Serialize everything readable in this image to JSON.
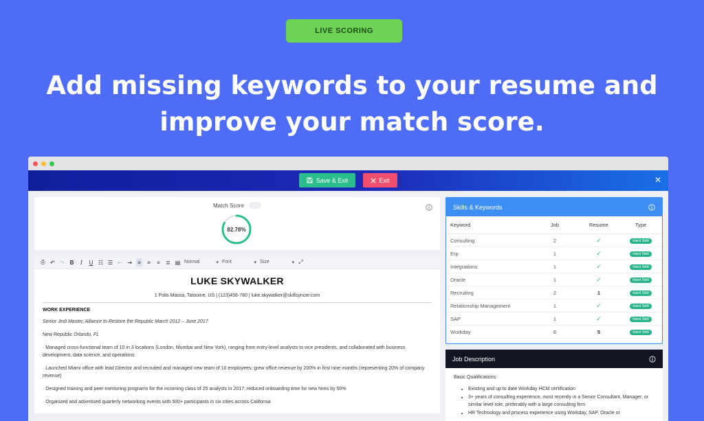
{
  "badge": "LIVE SCORING",
  "headline": {
    "line1": "Add missing keywords to your resume and",
    "line2": "improve your match score."
  },
  "appbar": {
    "save_label": "Save & Exit",
    "exit_label": "Exit",
    "close_glyph": "✕"
  },
  "score": {
    "label": "Match Score",
    "value_text": "82.78%",
    "value": 82.78
  },
  "toolbar": {
    "format_value": "Normal",
    "font_value": "Font",
    "size_value": "Size"
  },
  "resume": {
    "name": "LUKE SKYWALKER",
    "contact": "1 Polis Massa, Tatooine, US | (123)456-780 | luke.skywalker@skillsyncer.com",
    "section": "WORK EXPERIENCE",
    "role": "Senior Jedi Master, Alliance to Restore the Republic March 2012 – June 2017",
    "org_name": "New Republic",
    "org_location": "Orlando, FL",
    "bullets": [
      "· Managed cross-functional team of 10 in 3 locations (London, Mumbai and New York), ranging from entry-level analysts to vice presidents, and collaborated with business development, data science, and operations",
      "· Launched Miami office with lead Director and recruited and managed new team of 10 employees; grew office revenue by 200% in first nine months (representing 20% of company revenue)",
      "· Designed training and peer-mentoring programs for the incoming class of 25 analysts in 2017; reduced onboarding time for new hires by 50%",
      "· Organized and advertised quarterly networking events with 500+ participants in six cities across California"
    ]
  },
  "skills": {
    "title": "Skills & Keywords",
    "columns": [
      "Keyword",
      "Job",
      "Resume",
      "Type"
    ],
    "rows": [
      {
        "keyword": "Consulting",
        "job": "2",
        "resume": "✓",
        "type": "Hard Skill"
      },
      {
        "keyword": "Erp",
        "job": "1",
        "resume": "✓",
        "type": "Hard Skill"
      },
      {
        "keyword": "Integrations",
        "job": "1",
        "resume": "✓",
        "type": "Hard Skill"
      },
      {
        "keyword": "Oracle",
        "job": "1",
        "resume": "✓",
        "type": "Hard Skill"
      },
      {
        "keyword": "Recruiting",
        "job": "2",
        "resume": "1",
        "type": "Hard Skill"
      },
      {
        "keyword": "Relationship Management",
        "job": "1",
        "resume": "✓",
        "type": "Hard Skill"
      },
      {
        "keyword": "SAP",
        "job": "1",
        "resume": "✓",
        "type": "Hard Skill"
      },
      {
        "keyword": "Workday",
        "job": "8",
        "resume": "5",
        "type": "Hard Skill"
      }
    ]
  },
  "job_description": {
    "title": "Job Description",
    "subtitle": "Basic Qualifications:",
    "items": [
      "Existing and up to date Workday HCM certification",
      "3+ years of consulting experience, most recently in a Senior Consultant, Manager, or similar level role, preferably with a large consulting firm",
      "HR Technology and process experience using Workday, SAP, Oracle or"
    ]
  },
  "colors": {
    "background": "#4e6cf5",
    "badge": "#6cd356",
    "save": "#2bbd8d",
    "exit": "#f0506e",
    "skills_header": "#3d8ff3",
    "jd_header": "#111522",
    "gauge": "#2bbd8d"
  }
}
